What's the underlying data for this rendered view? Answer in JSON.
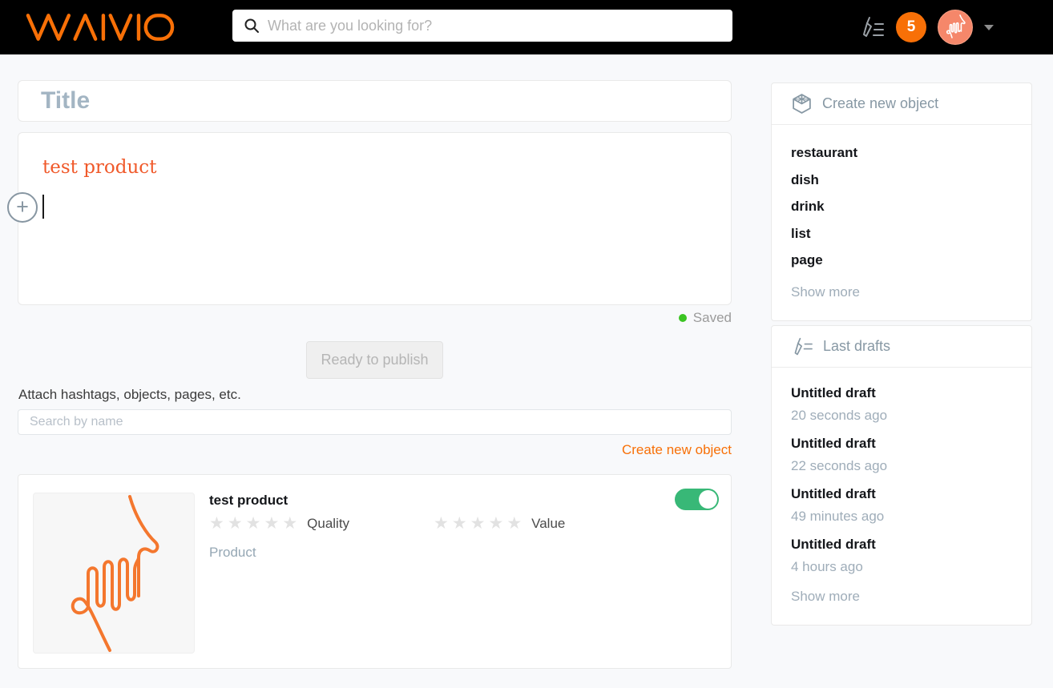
{
  "header": {
    "logo": "WAIVIO",
    "search_placeholder": "What are you looking for?",
    "notifications_count": "5"
  },
  "icons": {
    "star": "★",
    "plus": "+"
  },
  "editor": {
    "title_placeholder": "Title",
    "body_link_text": "test product",
    "saved_label": "Saved",
    "publish_button": "Ready to publish"
  },
  "attach": {
    "label": "Attach hashtags, objects, pages, etc.",
    "search_placeholder": "Search by name",
    "create_link": "Create new object"
  },
  "product_card": {
    "title": "test product",
    "ratings": [
      {
        "label": "Quality",
        "stars": 5,
        "filled": 0
      },
      {
        "label": "Value",
        "stars": 5,
        "filled": 0
      }
    ],
    "type_label": "Product",
    "toggle_on": true
  },
  "sidebar": {
    "create_object": {
      "title": "Create new object",
      "items": [
        "restaurant",
        "dish",
        "drink",
        "list",
        "page"
      ],
      "show_more": "Show more"
    },
    "last_drafts": {
      "title": "Last drafts",
      "items": [
        {
          "name": "Untitled draft",
          "time": "20 seconds ago"
        },
        {
          "name": "Untitled draft",
          "time": "22 seconds ago"
        },
        {
          "name": "Untitled draft",
          "time": "49 minutes ago"
        },
        {
          "name": "Untitled draft",
          "time": "4 hours ago"
        }
      ],
      "show_more": "Show more"
    }
  },
  "colors": {
    "accent_orange": "#f87007",
    "editor_link_orange": "#f0592a",
    "toggle_green": "#38b877",
    "saved_green": "#3bc422",
    "sidebar_heading_gray": "#8798a4"
  }
}
